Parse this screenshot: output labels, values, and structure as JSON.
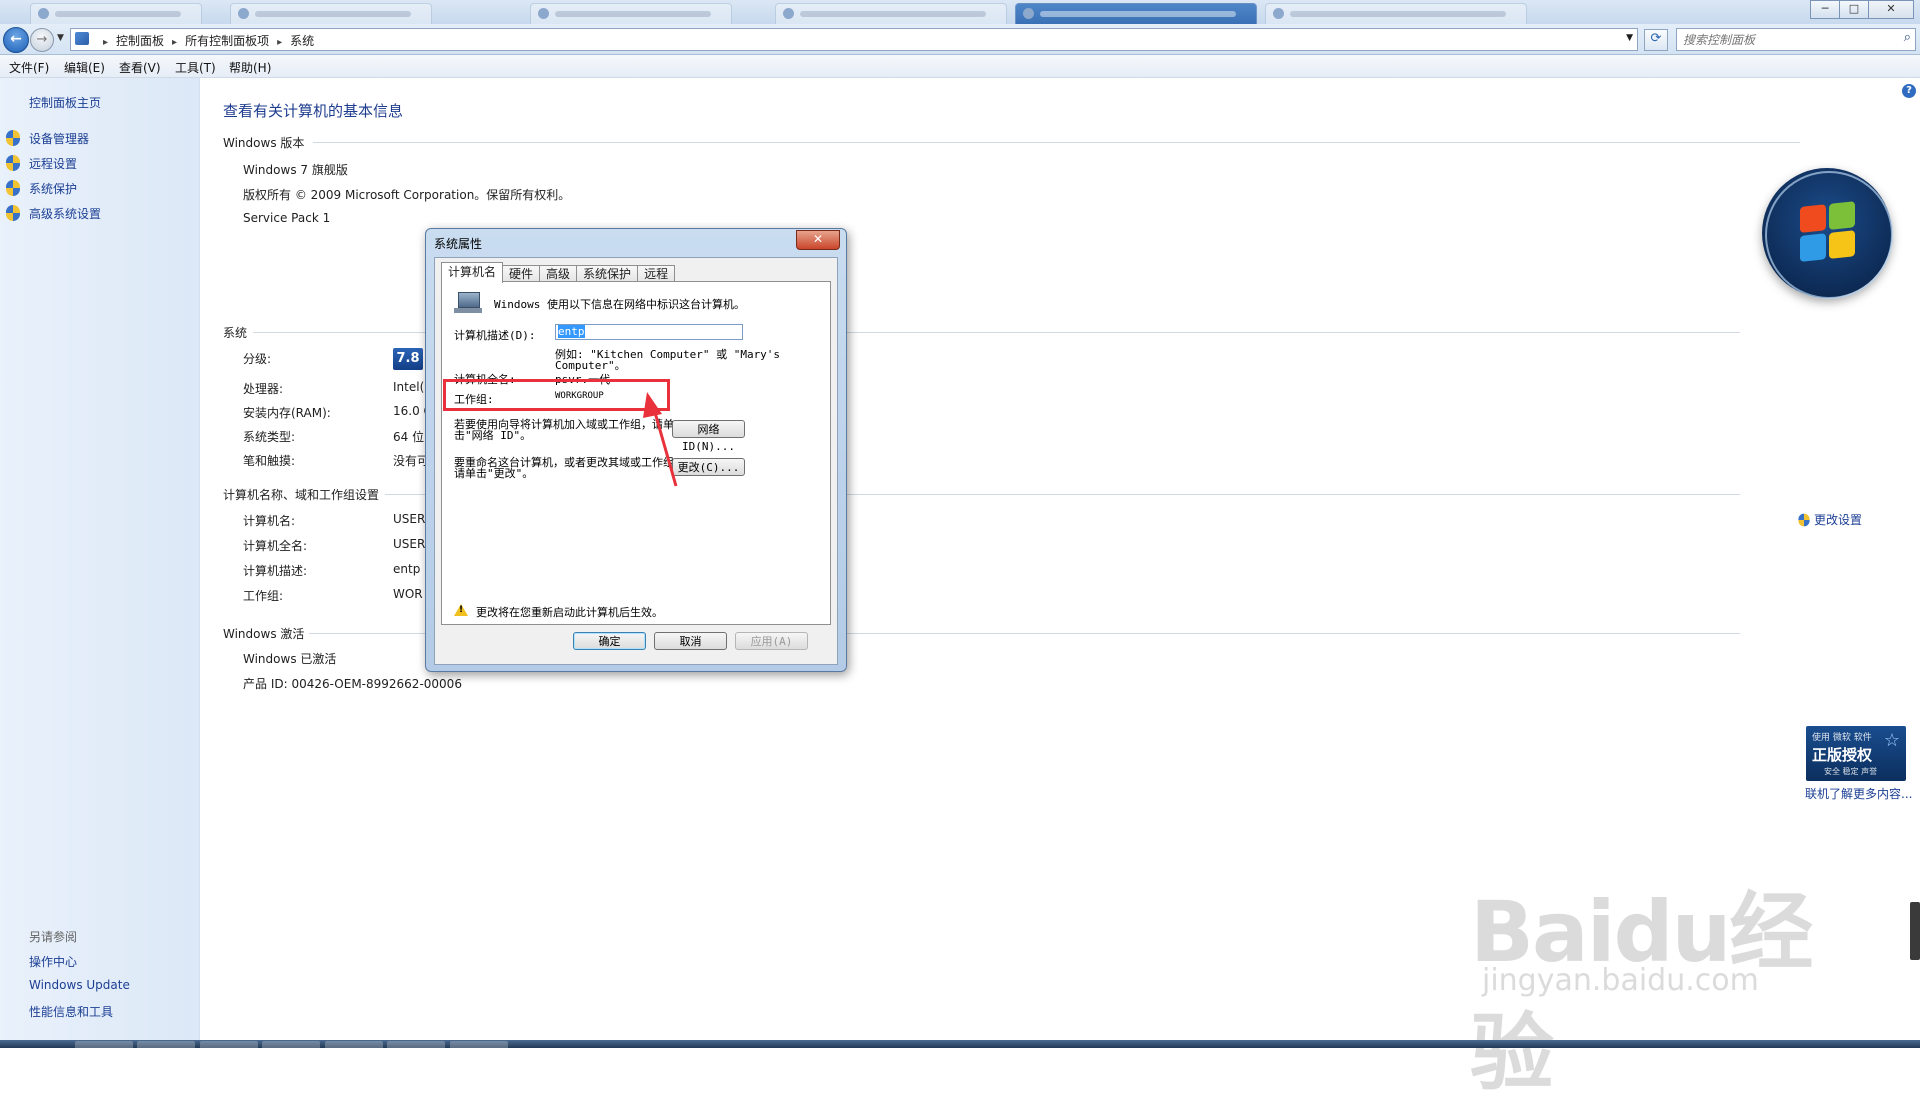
{
  "window": {
    "minimize": "─",
    "maximize": "□",
    "close": "✕"
  },
  "address": {
    "crumbs": [
      "控制面板",
      "所有控制面板项",
      "系统"
    ],
    "search_placeholder": "搜索控制面板"
  },
  "menu": [
    "文件(F)",
    "编辑(E)",
    "查看(V)",
    "工具(T)",
    "帮助(H)"
  ],
  "sidebar": {
    "home": "控制面板主页",
    "tasks": [
      "设备管理器",
      "远程设置",
      "系统保护",
      "高级系统设置"
    ],
    "see_also_title": "另请参阅",
    "see_also": [
      "操作中心",
      "Windows Update",
      "性能信息和工具"
    ]
  },
  "main": {
    "title": "查看有关计算机的基本信息",
    "edition": {
      "heading": "Windows 版本",
      "name": "Windows 7 旗舰版",
      "copyright": "版权所有 © 2009 Microsoft Corporation。保留所有权利。",
      "service_pack": "Service Pack 1"
    },
    "system": {
      "heading": "系统",
      "rows": [
        {
          "label": "分级:",
          "value": ""
        },
        {
          "label": "处理器:",
          "value": "Intel(R"
        },
        {
          "label": "安装内存(RAM):",
          "value": "16.0 G"
        },
        {
          "label": "系统类型:",
          "value": "64 位"
        },
        {
          "label": "笔和触摸:",
          "value": "没有可"
        }
      ],
      "score": "7.8"
    },
    "computer": {
      "heading": "计算机名称、域和工作组设置",
      "rows": [
        {
          "label": "计算机名:",
          "value": "USER"
        },
        {
          "label": "计算机全名:",
          "value": "USER"
        },
        {
          "label": "计算机描述:",
          "value": "entp"
        },
        {
          "label": "工作组:",
          "value": "WOR"
        }
      ],
      "change_settings": "更改设置"
    },
    "activation": {
      "heading": "Windows 激活",
      "status": "Windows 已激活",
      "product_id": "产品 ID: 00426-OEM-8992662-00006",
      "genuine_line1": "使用 微软 软件",
      "genuine_line2": "正版授权",
      "genuine_line3": "安全 稳定 声誉",
      "learn_more": "联机了解更多内容..."
    }
  },
  "dialog": {
    "title": "系统属性",
    "close": "✕",
    "tabs": [
      "计算机名",
      "硬件",
      "高级",
      "系统保护",
      "远程"
    ],
    "intro": "Windows 使用以下信息在网络中标识这台计算机。",
    "desc_label": "计算机描述(D):",
    "desc_value": "entp",
    "example_line1": "例如: \"Kitchen Computer\" 或 \"Mary's",
    "example_line2": "Computer\"。",
    "fullname_label": "计算机全名:",
    "fullname_value": "psvr.一代",
    "workgroup_label": "工作组:",
    "workgroup_value": "WORKGROUP",
    "network_text_line1": "若要使用向导将计算机加入域或工作组，请单",
    "network_text_line2": "击\"网络 ID\"。",
    "network_button": "网络 ID(N)...",
    "rename_text_line1": "要重命名这台计算机，或者更改其域或工作组，",
    "rename_text_line2": "请单击\"更改\"。",
    "change_button": "更改(C)...",
    "warning": "更改将在您重新启动此计算机后生效。",
    "ok": "确定",
    "cancel": "取消",
    "apply": "应用(A)"
  },
  "watermark": {
    "brand": "Baidu经验",
    "url": "jingyan.baidu.com"
  },
  "colors": {
    "link": "#1c3f94",
    "title": "#1e3d8f",
    "annotation": "#e8313a"
  }
}
